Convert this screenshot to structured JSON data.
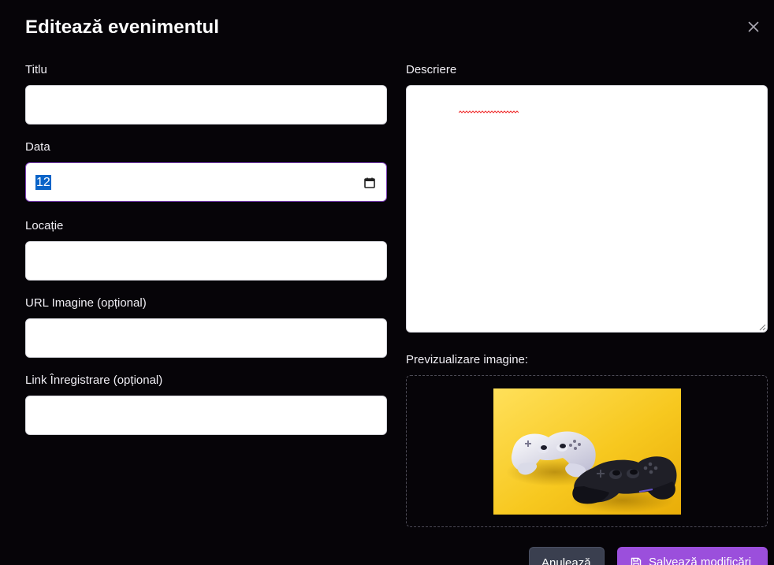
{
  "dialog": {
    "title": "Editează evenimentul"
  },
  "form": {
    "title_label": "Titlu",
    "title_value": "",
    "date_label": "Data",
    "date_value": "12",
    "location_label": "Locație",
    "location_value": "",
    "image_url_label": "URL Imagine (opțional)",
    "image_url_value": "",
    "registration_label": "Link Înregistrare (opțional)",
    "registration_value": "",
    "description_label": "Descriere",
    "description_value": ""
  },
  "preview": {
    "label": "Previzualizare imagine:",
    "image_subject": "white-and-black-game-controllers-on-yellow-background"
  },
  "actions": {
    "cancel_label": "Anulează",
    "save_label": "Salvează modificări"
  },
  "icons": {
    "close": "close-icon",
    "calendar": "calendar-icon",
    "save": "save-icon"
  },
  "colors": {
    "background": "#060408",
    "accent": "#9b4fdc",
    "cancel": "#3a3f4f",
    "selection": "#0a64c8"
  }
}
